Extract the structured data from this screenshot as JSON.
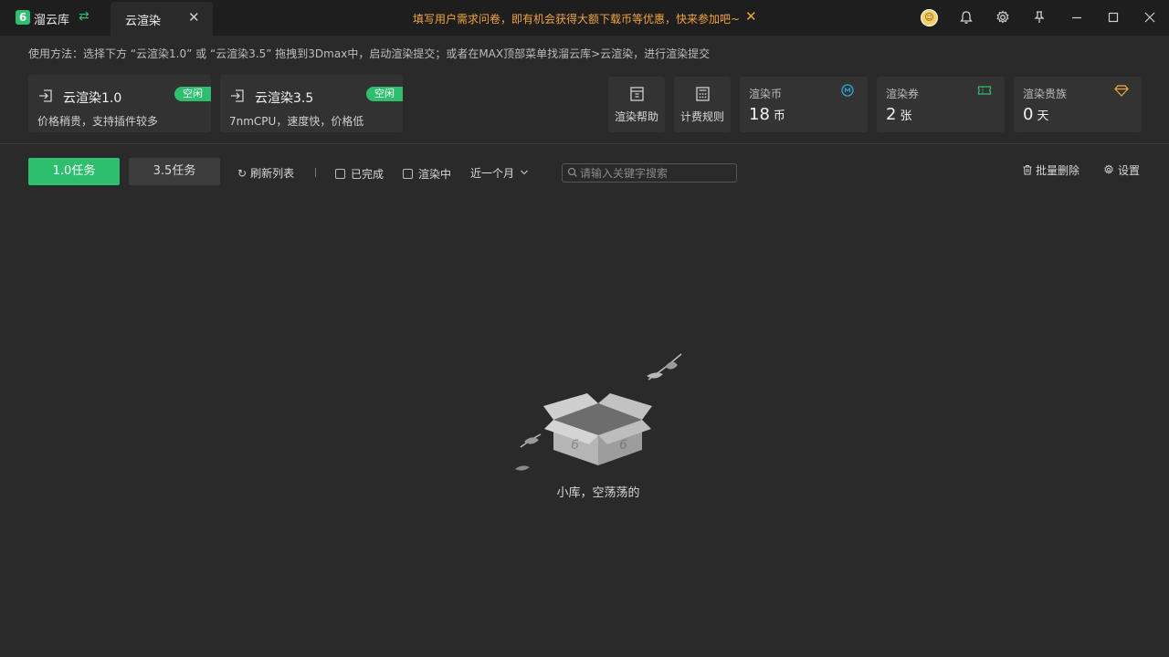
{
  "titlebar": {
    "logo_glyph": "6",
    "app_name": "溜云库",
    "tab_label": "云渲染",
    "notice": "填写用户需求问卷，即有机会获得大额下载币等优惠，快来参加吧~",
    "icons": [
      "switch-icon",
      "close-icon",
      "avatar",
      "bell-icon",
      "gear-icon",
      "pin-icon",
      "minimize-icon",
      "maximize-icon",
      "window-close-icon"
    ]
  },
  "howto": "使用方法：选择下方 “云渲染1.0” 或 “云渲染3.5” 拖拽到3Dmax中，启动渲染提交；或者在MAX顶部菜单找溜云库>云渲染，进行渲染提交",
  "render_cards": [
    {
      "title": "云渲染1.0",
      "desc": "价格稍贵，支持插件较多",
      "status": "空闲"
    },
    {
      "title": "云渲染3.5",
      "desc": "7nmCPU，速度快，价格低",
      "status": "空闲"
    }
  ],
  "shortcuts": [
    {
      "label": "渲染帮助",
      "icon": "help-book-icon"
    },
    {
      "label": "计费规则",
      "icon": "calculator-icon"
    }
  ],
  "stats": [
    {
      "title": "渲染币",
      "value": "18",
      "unit": "币",
      "icon": "coin-icon",
      "icon_color": "#2aa7e0"
    },
    {
      "title": "渲染券",
      "value": "2",
      "unit": "张",
      "icon": "ticket-icon",
      "icon_color": "#2dbf6e"
    },
    {
      "title": "渲染贵族",
      "value": "0",
      "unit": "天",
      "icon": "diamond-icon",
      "icon_color": "#f0a441"
    }
  ],
  "toolbar": {
    "tab_v1": "1.0任务",
    "tab_v35": "3.5任务",
    "refresh": "刷新列表",
    "filter_done": "已完成",
    "filter_rendering": "渲染中",
    "period": "近一个月",
    "search_placeholder": "请输入关键字搜索",
    "batch_delete": "批量删除",
    "settings": "设置"
  },
  "empty": {
    "message": "小库，空荡荡的"
  },
  "colors": {
    "accent": "#2dbf6e",
    "notice": "#f0a441",
    "background": "#2a2a2a",
    "titlebar": "#1e1e1e"
  }
}
